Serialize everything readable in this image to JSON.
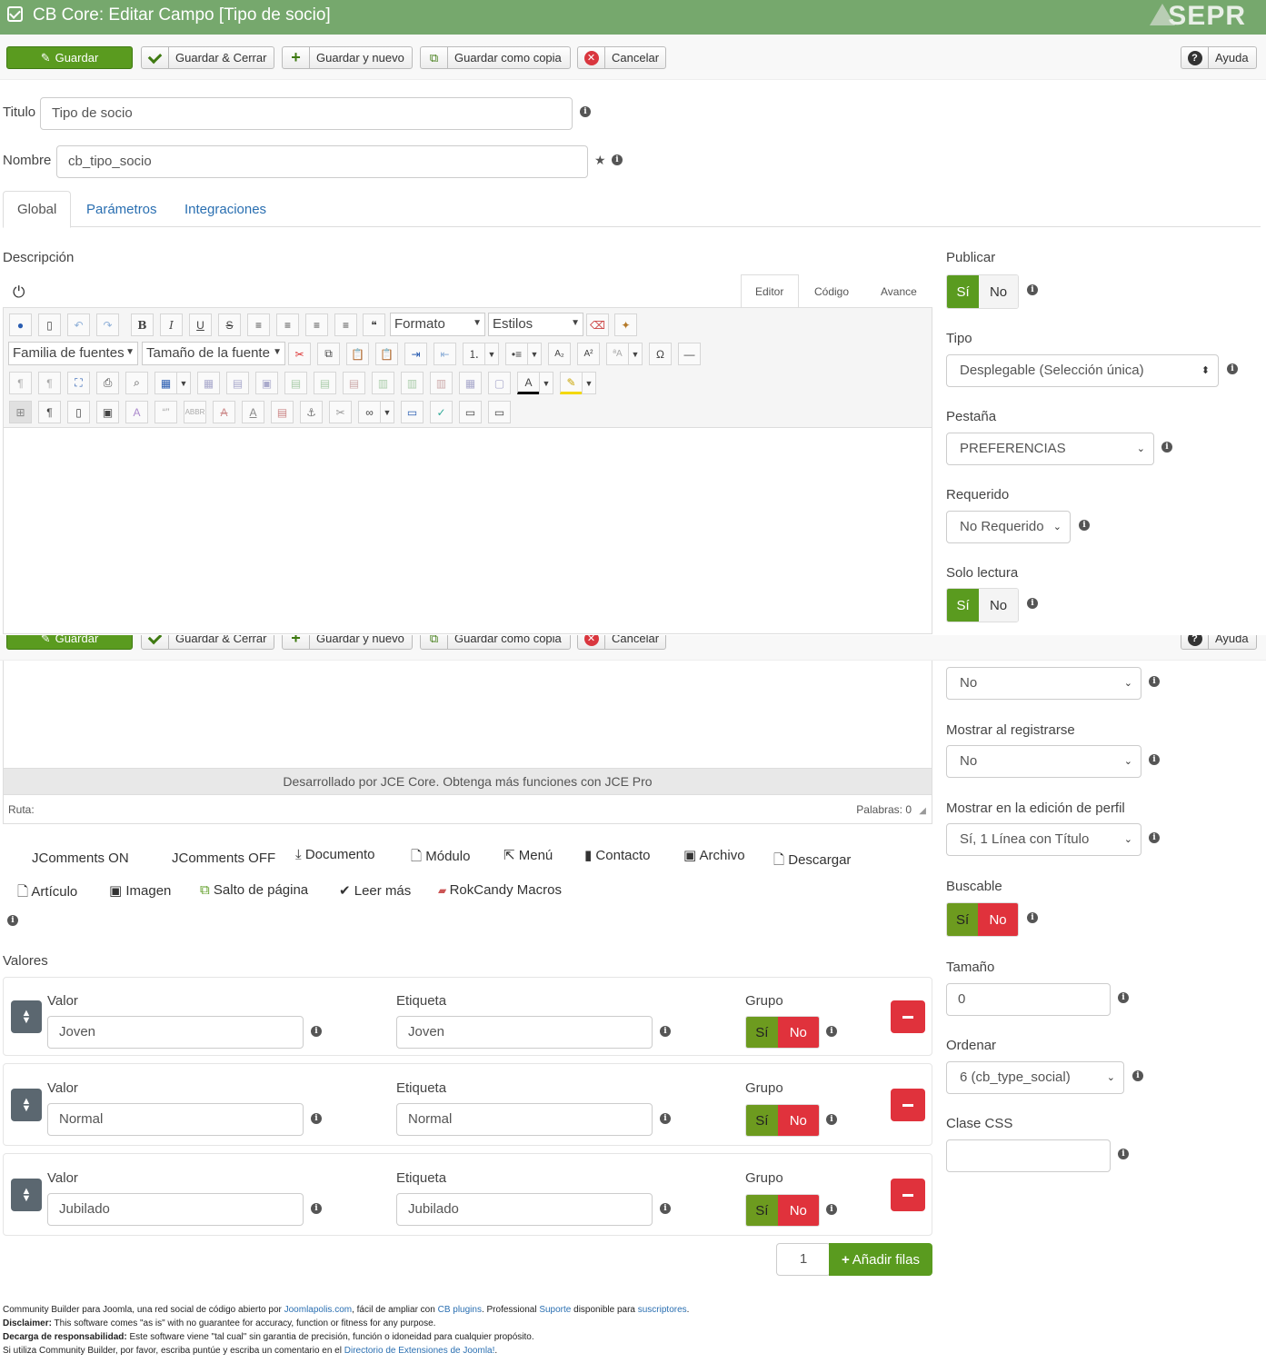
{
  "header": {
    "title": "CB Core: Editar Campo [Tipo de socio]",
    "logo": "SEPR"
  },
  "toolbar": {
    "save": "Guardar",
    "save_close": "Guardar & Cerrar",
    "save_new": "Guardar y nuevo",
    "save_copy": "Guardar como copia",
    "cancel": "Cancelar",
    "help": "Ayuda"
  },
  "form": {
    "title_label": "Titulo",
    "title_value": "Tipo de socio",
    "name_label": "Nombre",
    "name_value": "cb_tipo_socio"
  },
  "tabs": [
    "Global",
    "Parámetros",
    "Integraciones"
  ],
  "description": {
    "label": "Descripción",
    "editor_tabs": [
      "Editor",
      "Código",
      "Avance"
    ],
    "format": "Formato",
    "styles": "Estilos",
    "font_family": "Familia de fuentes",
    "font_size": "Tamaño de la fuente",
    "powered": "Desarrollado por JCE Core. Obtenga más funciones con JCE Pro",
    "path": "Ruta:",
    "words": "Palabras: 0"
  },
  "editor_buttons": {
    "row1": [
      "JComments ON",
      "JComments OFF",
      "Documento",
      "Módulo",
      "Menú",
      "Contacto",
      "Archivo",
      "Descargar"
    ],
    "row2": [
      "Artículo",
      "Imagen",
      "Salto de página",
      "Leer más",
      "RokCandy Macros"
    ]
  },
  "values": {
    "label": "Valores",
    "col_value": "Valor",
    "col_label": "Etiqueta",
    "col_group": "Grupo",
    "rows": [
      {
        "value": "Joven",
        "label": "Joven"
      },
      {
        "value": "Normal",
        "label": "Normal"
      },
      {
        "value": "Jubilado",
        "label": "Jubilado"
      }
    ],
    "add_count": "1",
    "add_button": "Añadir filas",
    "yes": "Sí",
    "no": "No"
  },
  "sidebar": {
    "publish_label": "Publicar",
    "type_label": "Tipo",
    "type_value": "Desplegable (Selección única)",
    "tab_label": "Pestaña",
    "tab_value": "PREFERENCIAS",
    "required_label": "Requerido",
    "required_value": "No Requerido",
    "readonly_label": "Solo lectura",
    "hidden_value": "No",
    "show_register_label": "Mostrar al registrarse",
    "show_register_value": "No",
    "show_profile_label": "Mostrar en la edición de perfil",
    "show_profile_value": "Sí, 1 Línea con Título",
    "searchable_label": "Buscable",
    "size_label": "Tamaño",
    "size_value": "0",
    "order_label": "Ordenar",
    "order_value": "6 (cb_type_social)",
    "css_label": "Clase CSS",
    "css_value": ""
  },
  "footer": {
    "line1_a": "Community Builder para Joomla, una red social de código abierto por ",
    "line1_link1": "Joomlapolis.com",
    "line1_b": ", fácil de ampliar con ",
    "line1_link2": "CB plugins",
    "line1_c": ". Professional ",
    "line1_link3": "Suporte",
    "line1_d": " disponible para ",
    "line1_link4": "suscriptores",
    "line1_e": ".",
    "line2_bold": "Disclaimer:",
    "line2": " This software comes \"as is\" with no guarantee for accuracy, function or fitness for any purpose.",
    "line3_bold": "Decarga de responsabilidad:",
    "line3": " Este software viene \"tal cual\" sin garantia de precisión, función o idoneidad para cualquier propósito.",
    "line4": "Si utiliza Community Builder, por favor, escriba puntúe y escriba un comentario en el ",
    "line4_link": "Directorio de Extensiones de Joomla!",
    "line4_end": "."
  },
  "colors": {
    "header": "#76a86d",
    "green": "#5a9b1f",
    "red": "#e0323c",
    "link": "#2a6fb1"
  }
}
